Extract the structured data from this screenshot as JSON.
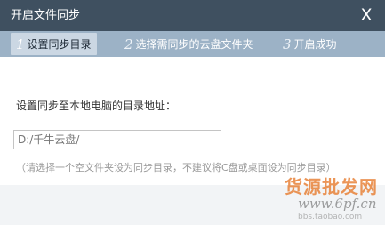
{
  "window": {
    "title": "开启文件同步",
    "close_label": "X"
  },
  "steps": [
    {
      "num": "1",
      "label": "设置同步目录"
    },
    {
      "num": "2",
      "label": "选择需同步的云盘文件夹"
    },
    {
      "num": "3",
      "label": "开启成功"
    }
  ],
  "form": {
    "label": "设置同步至本地电脑的目录地址：",
    "path_placeholder": "D:/千牛云盘/",
    "hint": "（请选择一个空文件夹设为同步目录，不建议将C盘或桌面设为同步目录）"
  },
  "watermark": {
    "line1": "货源批发网",
    "line2": "www.6pf.cn",
    "line3": "bbs.taobao.com"
  },
  "colors": {
    "titlebar": "#3f5060",
    "steps_bar": "#9cb2c6",
    "active_step": "#cbd7e3",
    "watermark": "#e8833a"
  }
}
